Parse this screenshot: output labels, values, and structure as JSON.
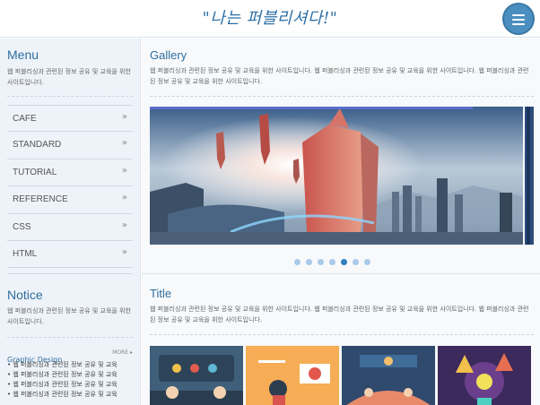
{
  "header": {
    "brand": "\"나는 퍼블리셔다!\"",
    "menu_button_icon": "hamburger-icon"
  },
  "sidebar": {
    "menu_title": "Menu",
    "menu_desc": "웹 퍼블리싱과 관련된 정보 공유 및 교육을 위한 사이트입니다.",
    "items": [
      {
        "label": "CAFE",
        "icon": "chevron-right-icon"
      },
      {
        "label": "STANDARD",
        "icon": "chevron-right-icon"
      },
      {
        "label": "TUTORIAL",
        "icon": "chevron-right-icon"
      },
      {
        "label": "REFERENCE",
        "icon": "chevron-right-icon"
      },
      {
        "label": "CSS",
        "icon": "chevron-right-icon"
      },
      {
        "label": "HTML",
        "icon": "chevron-right-icon"
      }
    ],
    "chevron": "»",
    "notice_title": "Notice",
    "notice_desc": "웹 퍼블리싱과 관련된 정보 공유 및 교육을 위한 사이트입니다.",
    "graphic_title": "Graphic Design",
    "more_label": "MORE ▸",
    "graphic_items": [
      "• 웹 퍼블리싱과 관련된 정보 공유 및 교육",
      "• 웹 퍼블리싱과 관련된 정보 공유 및 교육",
      "• 웹 퍼블리싱과 관련된 정보 공유 및 교육",
      "• 웹 퍼블리싱과 관련된 정보 공유 및 교육"
    ]
  },
  "main": {
    "gallery_title": "Gallery",
    "gallery_desc": "웹 퍼블리싱과 관련된 정보 공유 및 교육을 위한 사이트입니다. 웹 퍼블리싱과 관련된 정보 공유 및 교육을 위한 사이트입니다. 웹 퍼블리싱과 관련된 정보 공유 및 교육을 위한 사이트입니다.",
    "slider": {
      "slide_count": 7,
      "active_index": 4,
      "progress": 0.84
    },
    "title": "Title",
    "title_desc": "웹 퍼블리싱과 관련된 정보 공유 및 교육을 위한 사이트입니다. 웹 퍼블리싱과 관련된 정보 공유 및 교육을 위한 사이트입니다. 웹 퍼블리싱과 관련된 정보 공유 및 교육을 위한 사이트입니다."
  },
  "colors": {
    "accent": "#2f6d9e",
    "dot_active": "#2f7fc0",
    "dot_inactive": "#a9cbe9",
    "sidebar_bg": "#eef3f9"
  }
}
